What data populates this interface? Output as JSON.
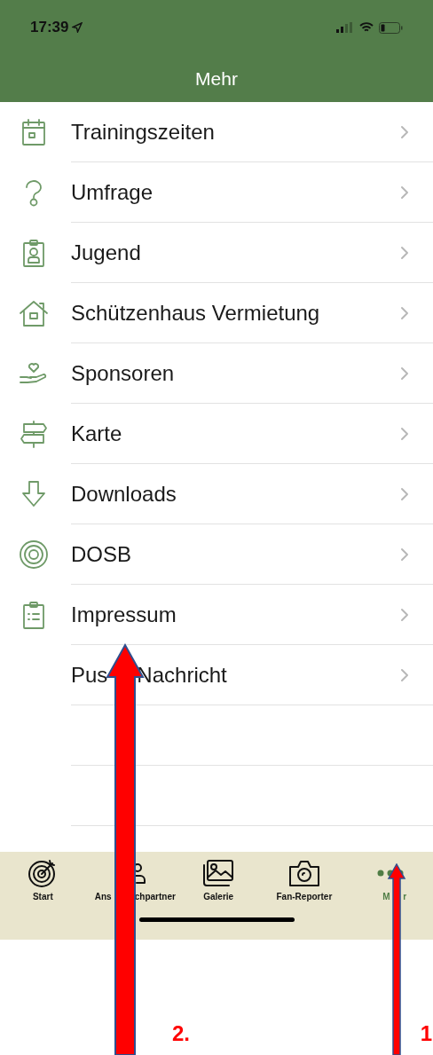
{
  "status_bar": {
    "time": "17:39"
  },
  "nav_bar": {
    "title": "Mehr"
  },
  "menu": [
    {
      "label_parts": [
        "Trainingszeiten"
      ]
    },
    {
      "label_parts": [
        "Umfrage"
      ]
    },
    {
      "label_parts": [
        "Jugend"
      ]
    },
    {
      "label_parts": [
        "Schützenhaus Vermietung"
      ]
    },
    {
      "label_parts": [
        "Sponsoren"
      ]
    },
    {
      "label_parts": [
        "Karte"
      ]
    },
    {
      "label_parts": [
        "Downloads"
      ]
    },
    {
      "label_parts": [
        "DOSB"
      ]
    },
    {
      "label_parts": [
        "Impressum"
      ]
    },
    {
      "label_parts": [
        "Pus",
        "Nachricht"
      ]
    }
  ],
  "tab_bar": [
    {
      "label_parts": [
        "Start"
      ],
      "selected": false
    },
    {
      "label_parts": [
        "Ans",
        "chpartner"
      ],
      "selected": false
    },
    {
      "label_parts": [
        "Galerie"
      ],
      "selected": false
    },
    {
      "label_parts": [
        "Fan-Reporter"
      ],
      "selected": false
    },
    {
      "label_parts": [
        "M",
        "r"
      ],
      "selected": true
    }
  ],
  "annotations": [
    {
      "label": "2."
    },
    {
      "label": "1"
    }
  ]
}
